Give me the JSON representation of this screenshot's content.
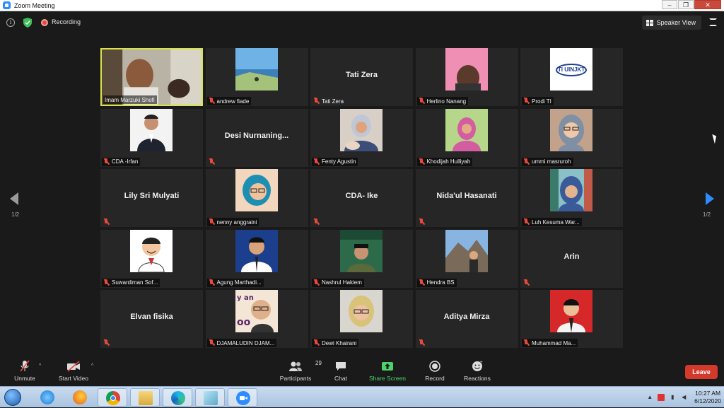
{
  "window": {
    "title": "Zoom Meeting",
    "min": "–",
    "max": "❐",
    "close": "✕"
  },
  "topbar": {
    "recording_label": "Recording",
    "view_button": "Speaker View"
  },
  "pagination": {
    "left": "1/2",
    "right": "1/2"
  },
  "participants": [
    {
      "name": "Imam Marzuki Shofi",
      "display": "video",
      "active": true
    },
    {
      "name": "andrew fiade",
      "display": "photo"
    },
    {
      "name": "Tati Zera",
      "display": "name"
    },
    {
      "name": "Herlino Nanang",
      "display": "photo"
    },
    {
      "name": "Prodi TI",
      "display": "logo",
      "logo_text": "TI UINJKT"
    },
    {
      "name": "CDA -Irfan",
      "display": "photo"
    },
    {
      "name": "Desi Nurnaning...",
      "display": "name",
      "label": ""
    },
    {
      "name": "Fenty Agustin",
      "display": "photo"
    },
    {
      "name": "Khodijah Hulliyah",
      "display": "photo"
    },
    {
      "name": "ummi masruroh",
      "display": "photo"
    },
    {
      "name": "Lily Sri Mulyati",
      "display": "name",
      "label": ""
    },
    {
      "name": "nenny anggraini",
      "display": "photo"
    },
    {
      "name": "CDA- Ike",
      "display": "name",
      "label": ""
    },
    {
      "name": "Nida'ul Hasanati",
      "display": "name",
      "label": ""
    },
    {
      "name": "Luh Kesuma War...",
      "display": "photo"
    },
    {
      "name": "Suwardiman Sof...",
      "display": "photo"
    },
    {
      "name": "Agung Marthadi...",
      "display": "photo"
    },
    {
      "name": "Nashrul Hakiem",
      "display": "photo"
    },
    {
      "name": "Hendra BS",
      "display": "photo"
    },
    {
      "name": "Arin",
      "display": "name",
      "label": ""
    },
    {
      "name": "Elvan fisika",
      "display": "name",
      "label": ""
    },
    {
      "name": "DJAMALUDIN DJAM...",
      "display": "photo"
    },
    {
      "name": "Dewi Khairani",
      "display": "photo"
    },
    {
      "name": "Aditya Mirza",
      "display": "name",
      "label": ""
    },
    {
      "name": "Muhammad Ma...",
      "display": "photo"
    }
  ],
  "toolbar": {
    "unmute": "Unmute",
    "start_video": "Start Video",
    "participants": "Participants",
    "participants_count": "29",
    "chat": "Chat",
    "share_screen": "Share Screen",
    "record": "Record",
    "reactions": "Reactions",
    "leave": "Leave"
  },
  "taskbar": {
    "time": "10:27 AM",
    "date": "6/12/2020"
  },
  "colors": {
    "active_speaker": "#d7e34b",
    "share_green": "#4dd36a",
    "leave_red": "#d33a2c",
    "accent_blue": "#2d8cff"
  }
}
